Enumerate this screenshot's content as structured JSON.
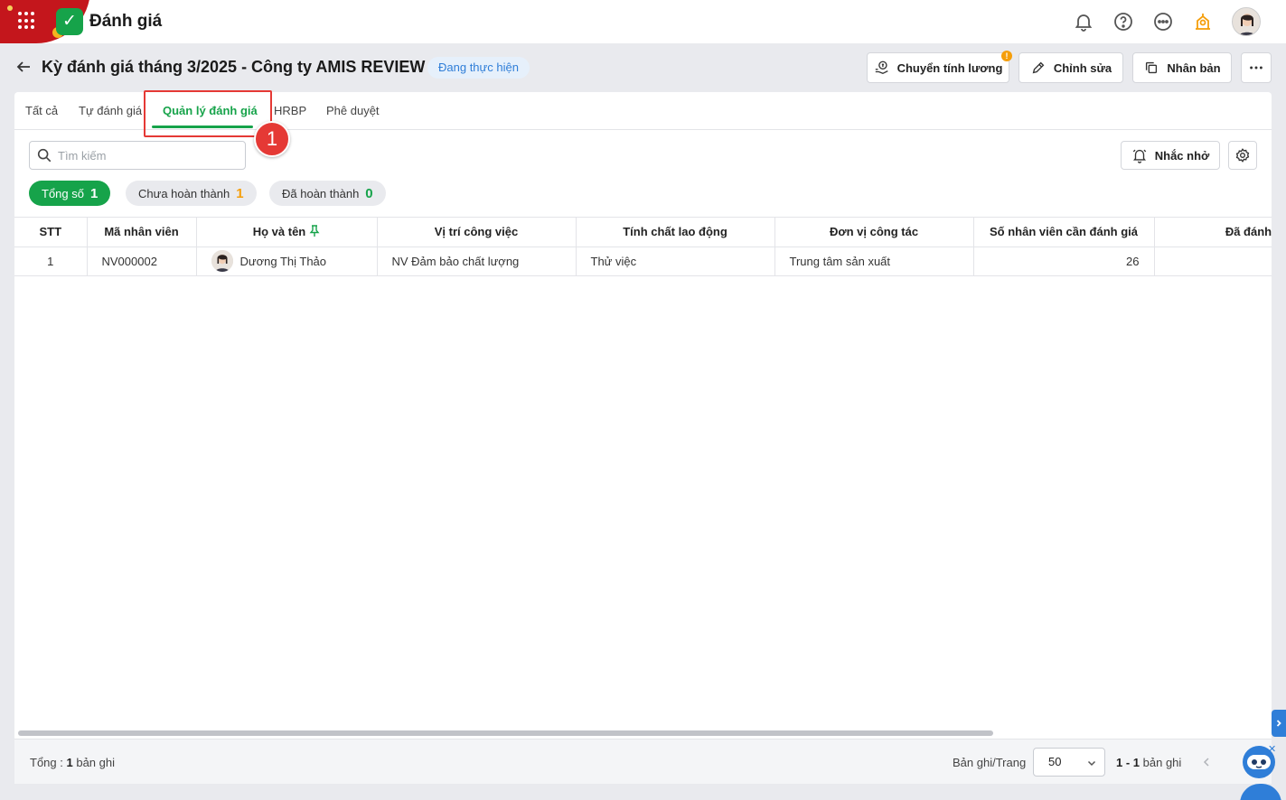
{
  "app": {
    "title": "Đánh giá"
  },
  "header": {
    "page_title": "Kỳ đánh giá tháng 3/2025 - Công ty AMIS REVIEW",
    "status": "Đang thực hiện",
    "buttons": {
      "transfer_salary": "Chuyển tính lương",
      "transfer_salary_alert": "!",
      "edit": "Chỉnh sửa",
      "duplicate": "Nhân bản"
    }
  },
  "tabs": [
    {
      "label": "Tất cả",
      "active": false
    },
    {
      "label": "Tự đánh giá",
      "active": false
    },
    {
      "label": "Quản lý đánh giá",
      "active": true
    },
    {
      "label": "HRBP",
      "active": false
    },
    {
      "label": "Phê duyệt",
      "active": false
    }
  ],
  "annotation": {
    "step_number": "1"
  },
  "toolbar": {
    "search_placeholder": "Tìm kiếm",
    "remind_label": "Nhắc nhở"
  },
  "filters": [
    {
      "label": "Tổng số",
      "count": "1"
    },
    {
      "label": "Chưa hoàn thành",
      "count": "1"
    },
    {
      "label": "Đã hoàn thành",
      "count": "0"
    }
  ],
  "table": {
    "columns": [
      "STT",
      "Mã nhân viên",
      "Họ và tên",
      "Vị trí công việc",
      "Tính chất lao động",
      "Đơn vị công tác",
      "Số nhân viên cần đánh giá",
      "Đã đánh giá"
    ],
    "rows": [
      {
        "stt": "1",
        "code": "NV000002",
        "name": "Dương Thị Thảo",
        "position": "NV Đảm bảo chất lượng",
        "labor_type": "Thử việc",
        "unit": "Trung tâm sản xuất",
        "need_review": "26",
        "reviewed": ""
      }
    ]
  },
  "footer": {
    "total_prefix": "Tổng :",
    "total_count": "1",
    "total_suffix": "bản ghi",
    "per_page_label": "Bản ghi/Trang",
    "per_page_value": "50",
    "range_text": "1 - 1",
    "range_suffix": "bản ghi"
  },
  "colors": {
    "primary_green": "#16a34a",
    "status_blue": "#2f7ed8",
    "warning_orange": "#f59e0b",
    "highlight_red": "#e53935"
  }
}
